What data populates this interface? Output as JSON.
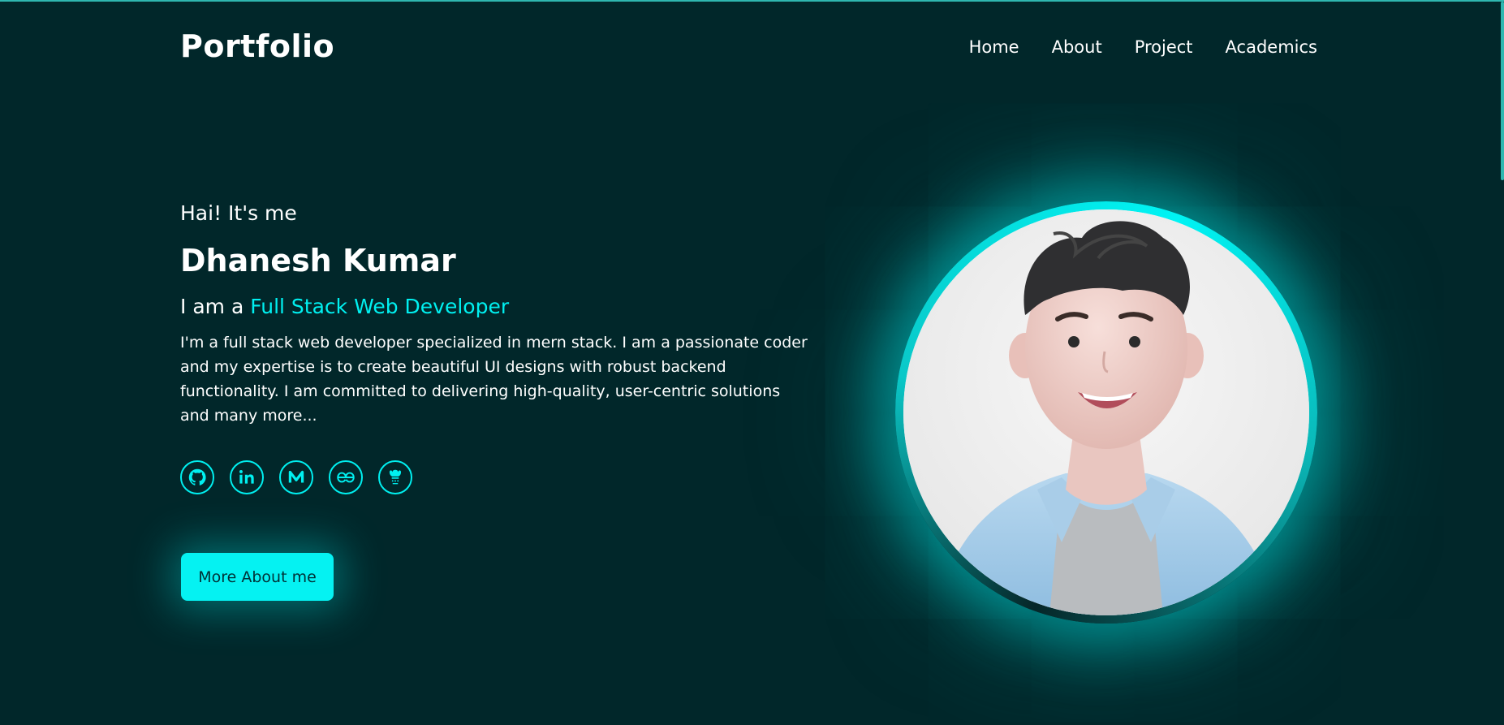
{
  "header": {
    "logo": "Portfolio",
    "nav": [
      "Home",
      "About",
      "Project",
      "Academics"
    ]
  },
  "hero": {
    "greeting": "Hai! It's me",
    "name": "Dhanesh Kumar",
    "role_prefix": "I am a",
    "role_highlight": "Full Stack Web Developer",
    "bio": "I'm a full stack web developer specialized in mern stack. I am a passionate coder and my expertise is to create beautiful UI designs with robust backend functionality. I am committed to delivering high-quality, user-centric solutions and many more...",
    "cta_label": "More About me"
  },
  "socials": [
    {
      "icon": "github-icon"
    },
    {
      "icon": "linkedin-icon"
    },
    {
      "icon": "medium-icon"
    },
    {
      "icon": "geeksforgeeks-icon"
    },
    {
      "icon": "codechef-icon"
    }
  ],
  "colors": {
    "background": "#01272a",
    "accent": "#00f0f0",
    "button": "#05f2f2",
    "button_text": "#013236"
  }
}
